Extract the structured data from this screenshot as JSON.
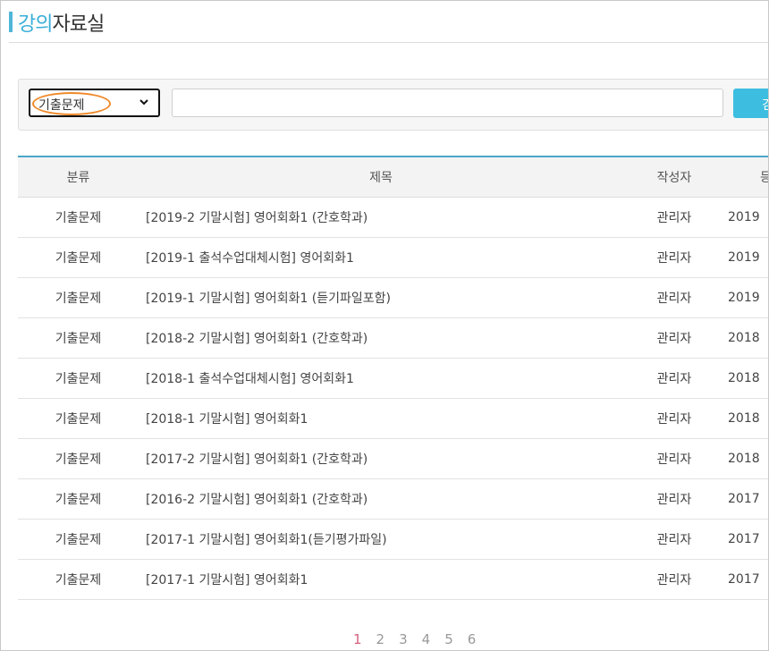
{
  "page_title": {
    "accent": "강의",
    "rest": "자료실"
  },
  "search": {
    "category_selected": "기출문제",
    "keyword_value": "",
    "button_label": "검",
    "accent_color": "#3dbde0"
  },
  "table": {
    "headers": [
      "분류",
      "제목",
      "작성자",
      "등"
    ],
    "rows": [
      {
        "category": "기출문제",
        "title": "[2019-2 기말시험] 영어회화1 (간호학과)",
        "writer": "관리자",
        "date": "2019"
      },
      {
        "category": "기출문제",
        "title": "[2019-1 출석수업대체시험] 영어회화1",
        "writer": "관리자",
        "date": "2019"
      },
      {
        "category": "기출문제",
        "title": "[2019-1 기말시험] 영어회화1 (듣기파일포함)",
        "writer": "관리자",
        "date": "2019"
      },
      {
        "category": "기출문제",
        "title": "[2018-2 기말시험] 영어회화1 (간호학과)",
        "writer": "관리자",
        "date": "2018"
      },
      {
        "category": "기출문제",
        "title": "[2018-1 출석수업대체시험] 영어회화1",
        "writer": "관리자",
        "date": "2018"
      },
      {
        "category": "기출문제",
        "title": "[2018-1 기말시험] 영어회화1",
        "writer": "관리자",
        "date": "2018"
      },
      {
        "category": "기출문제",
        "title": "[2017-2 기말시험] 영어회화1 (간호학과)",
        "writer": "관리자",
        "date": "2018"
      },
      {
        "category": "기출문제",
        "title": "[2016-2 기말시험] 영어회화1 (간호학과)",
        "writer": "관리자",
        "date": "2017"
      },
      {
        "category": "기출문제",
        "title": "[2017-1 기말시험] 영어회화1(듣기평가파일)",
        "writer": "관리자",
        "date": "2017"
      },
      {
        "category": "기출문제",
        "title": "[2017-1 기말시험] 영어회화1",
        "writer": "관리자",
        "date": "2017"
      }
    ]
  },
  "pagination": {
    "pages": [
      "1",
      "2",
      "3",
      "4",
      "5",
      "6"
    ],
    "current": "1"
  },
  "icons": {
    "select_arrow": "chevron-down-icon"
  }
}
